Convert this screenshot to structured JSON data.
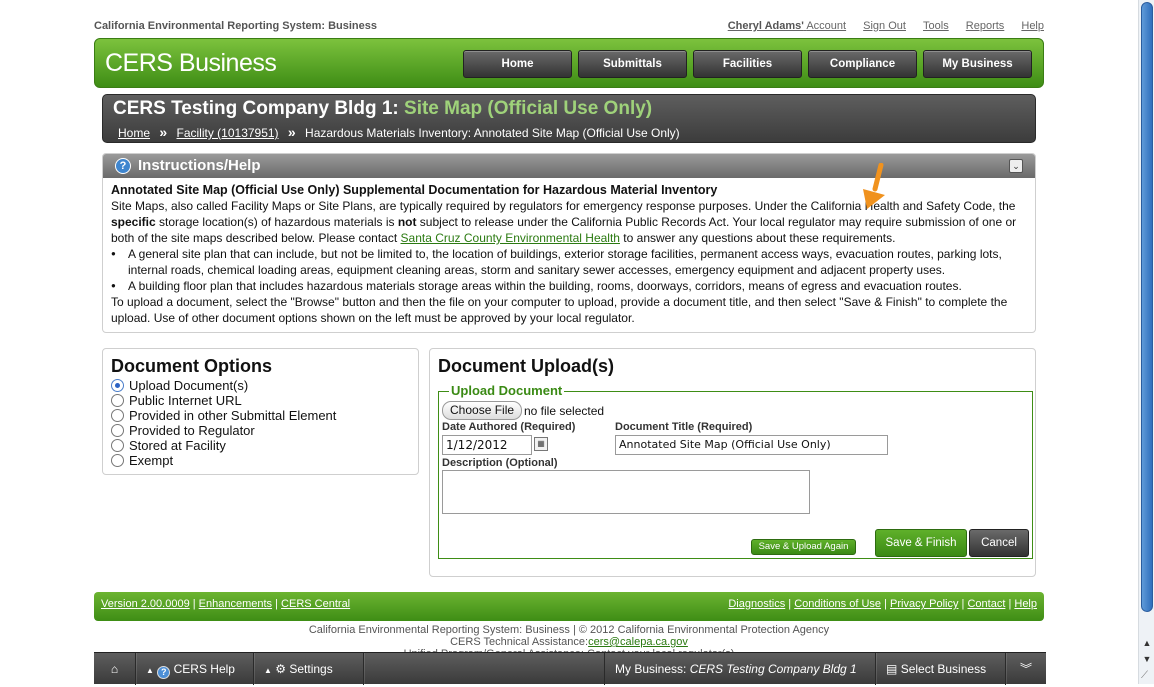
{
  "topbar": {
    "brand": "California Environmental Reporting System: Business",
    "user_name": "Cheryl Adams'",
    "account": "Account",
    "sign_out": "Sign Out",
    "tools": "Tools",
    "reports": "Reports",
    "help": "Help"
  },
  "header": {
    "logo": "CERS Business",
    "nav": [
      "Home",
      "Submittals",
      "Facilities",
      "Compliance",
      "My Business"
    ]
  },
  "banner": {
    "title_main": "CERS Testing Company Bldg 1:",
    "title_sub": "Site Map (Official Use Only)",
    "crumb_home": "Home",
    "crumb_facility": "Facility (10137951)",
    "crumb_current": "Hazardous Materials Inventory: Annotated Site Map (Official Use Only)",
    "sep": "»"
  },
  "instructions": {
    "heading": "Instructions/Help",
    "lead": "Annotated Site Map (Official Use Only) Supplemental Documentation for Hazardous Material Inventory",
    "p1_a": "Site Maps, also called Facility Maps or Site Plans, are typically required by regulators for emergency response purposes. Under the California Health and Safety Code, the ",
    "p1_b": "specific",
    "p1_c": " storage location(s) of hazardous materials is ",
    "p1_d": "not",
    "p1_e": " subject to release under the California Public Records Act. Your local regulator may require submission of one or both of the site maps described below. Please contact ",
    "p1_link": "Santa Cruz County Environmental Health",
    "p1_f": " to answer any questions about these requirements.",
    "bullet1": "A general site plan that can include, but not be limited to, the location of buildings, exterior storage facilities, permanent access ways, evacuation routes, parking lots, internal roads, chemical loading areas, equipment cleaning areas, storm and sanitary sewer accesses, emergency equipment and adjacent property uses.",
    "bullet2": "A building floor plan that includes hazardous materials storage areas within the building, rooms, doorways, corridors, means of egress and evacuation routes.",
    "p2": "To upload a document, select the \"Browse\" button and then the file on your computer to upload, provide a document title, and then select \"Save & Finish\" to complete the upload. Use of other document options shown on the left must be approved by your local regulator."
  },
  "doc_options": {
    "title": "Document Options",
    "options": [
      "Upload Document(s)",
      "Public Internet URL",
      "Provided in other Submittal Element",
      "Provided to Regulator",
      "Stored at Facility",
      "Exempt"
    ],
    "selected": "Upload Document(s)"
  },
  "upload": {
    "title": "Document Upload(s)",
    "legend": "Upload Document",
    "choose_file": "Choose File",
    "no_file": "no file selected",
    "date_label": "Date Authored (Required)",
    "date_value": "1/12/2012",
    "doc_title_label": "Document Title (Required)",
    "doc_title_value": "Annotated Site Map (Official Use Only)",
    "desc_label": "Description (Optional)",
    "save_upload_again": "Save & Upload Again",
    "save_finish": "Save & Finish",
    "cancel": "Cancel"
  },
  "footer": {
    "version": "Version 2.00.0009",
    "enhancements": "Enhancements",
    "cers_central": "CERS Central",
    "diagnostics": "Diagnostics",
    "conditions": "Conditions of Use",
    "privacy": "Privacy Policy",
    "contact": "Contact",
    "help": "Help",
    "line1": "California Environmental Reporting System: Business | © 2012 California Environmental Protection Agency",
    "line2_label": "CERS Technical Assistance:",
    "line2_email": "cers@calepa.ca.gov",
    "line3": "Unified Program/General Assistance: Contact your local regulator(s)"
  },
  "toolbar": {
    "cers_help": "CERS Help",
    "settings": "Settings",
    "my_business_label": "My Business:",
    "my_business_value": "CERS Testing Company Bldg 1",
    "select_business": "Select Business"
  },
  "colors": {
    "brand_green": "#3e8d15",
    "banner_dark": "#3c3c3c",
    "accent_orange": "#f0921e"
  }
}
